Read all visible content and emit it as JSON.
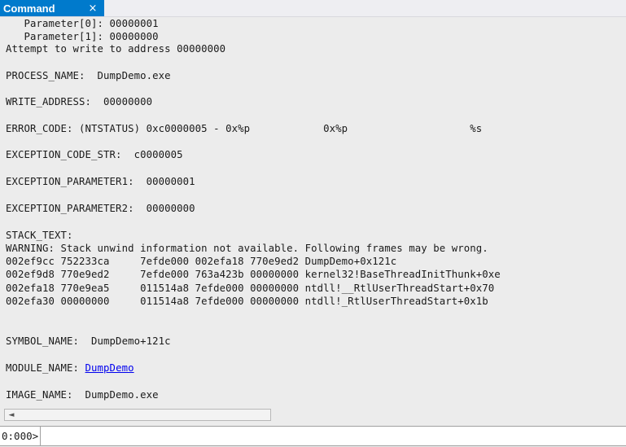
{
  "window": {
    "tab_title": "Command",
    "close_icon": "×"
  },
  "output": {
    "lines": [
      "   Parameter[0]: 00000001",
      "   Parameter[1]: 00000000",
      "Attempt to write to address 00000000",
      "",
      "PROCESS_NAME:  DumpDemo.exe",
      "",
      "WRITE_ADDRESS:  00000000",
      "",
      "ERROR_CODE: (NTSTATUS) 0xc0000005 - 0x%p            0x%p                    %s",
      "",
      "EXCEPTION_CODE_STR:  c0000005",
      "",
      "EXCEPTION_PARAMETER1:  00000001",
      "",
      "EXCEPTION_PARAMETER2:  00000000",
      "",
      "STACK_TEXT:",
      "WARNING: Stack unwind information not available. Following frames may be wrong.",
      "002ef9cc 752233ca     7efde000 002efa18 770e9ed2 DumpDemo+0x121c",
      "002ef9d8 770e9ed2     7efde000 763a423b 00000000 kernel32!BaseThreadInitThunk+0xe",
      "002efa18 770e9ea5     011514a8 7efde000 00000000 ntdll!__RtlUserThreadStart+0x70",
      "002efa30 00000000     011514a8 7efde000 00000000 ntdll!_RtlUserThreadStart+0x1b",
      "",
      "",
      "SYMBOL_NAME:  DumpDemo+121c",
      "",
      "MODULE_NAME: ",
      "",
      "IMAGE_NAME:  DumpDemo.exe"
    ],
    "module_link": "DumpDemo"
  },
  "scrollbar": {
    "left_arrow_icon": "◄"
  },
  "command": {
    "prompt": "0:000>",
    "input_value": ""
  }
}
